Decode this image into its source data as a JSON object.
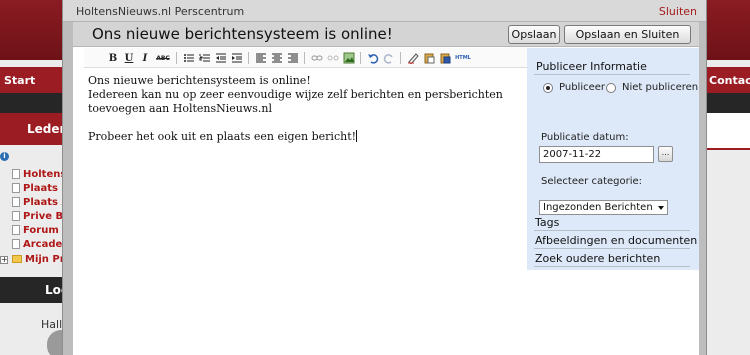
{
  "background": {
    "nav_start": "Start",
    "nav_contact": "Contact",
    "leden_label": "Leden",
    "tree_items": [
      {
        "label": "Holtens I",
        "icon": "document-icon"
      },
      {
        "label": "Plaats Ev",
        "icon": "document-icon"
      },
      {
        "label": "Plaats Ac",
        "icon": "document-icon"
      },
      {
        "label": "Prive Ber",
        "icon": "document-icon"
      },
      {
        "label": "Forum",
        "icon": "document-icon"
      },
      {
        "label": "Arcadeh",
        "icon": "document-icon"
      },
      {
        "label": "Mijn Prof",
        "icon": "folder-icon"
      }
    ],
    "login_label": "Log",
    "hallo_label": "Hallo"
  },
  "modal": {
    "title": "HoltensNieuws.nl Perscentrum",
    "close_label": "Sluiten",
    "headline": "Ons nieuwe berichtensysteem is online!",
    "save_label": "Opslaan",
    "save_close_label": "Opslaan en Sluiten"
  },
  "editor": {
    "toolbar_icons": [
      "bold-icon",
      "underline-icon",
      "italic-icon",
      "strikethrough-icon",
      "bullet-list-icon",
      "numbered-list-icon",
      "outdent-icon",
      "indent-icon",
      "align-left-icon",
      "align-center-icon",
      "align-right-icon",
      "link-icon",
      "unlink-icon",
      "image-icon",
      "undo-icon",
      "redo-icon",
      "clean-format-icon",
      "paste-icon",
      "paste-word-icon",
      "html-icon"
    ],
    "bold_glyph": "B",
    "underline_glyph": "U",
    "italic_glyph": "I",
    "strike_glyph": "ABC",
    "html_glyph": "HTML",
    "paragraphs": [
      "Ons nieuwe berichtensysteem is online!",
      "Iedereen kan nu op zeer eenvoudige wijze zelf berichten en persberichten",
      "toevoegen aan HoltensNieuws.nl",
      "",
      "Probeer het ook uit en plaats een eigen bericht!"
    ]
  },
  "panel": {
    "publish_heading": "Publiceer Informatie",
    "radio_publish": "Publiceer",
    "radio_no_publish": "Niet publiceren",
    "publish_selected": "Publiceer",
    "date_label": "Publicatie datum:",
    "date_value": "2007-11-22",
    "date_button": "...",
    "category_label": "Selecteer categorie:",
    "category_value": "Ingezonden Berichten",
    "tags_label": "Tags",
    "media_label": "Afbeeldingen en documenten",
    "search_label": "Zoek oudere berichten"
  }
}
